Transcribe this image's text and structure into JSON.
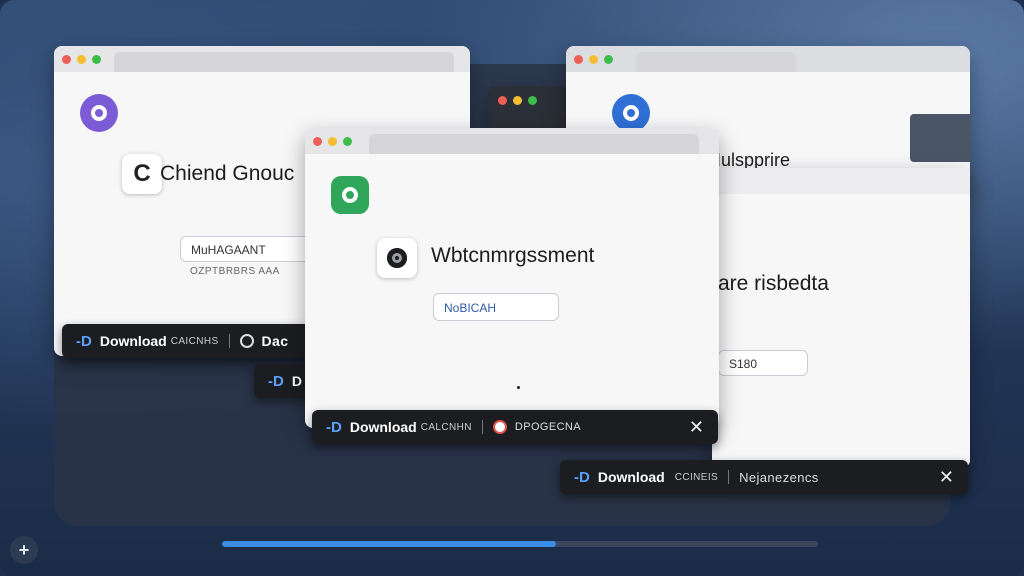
{
  "colors": {
    "accent": "#3d8ce8",
    "download_icon": "#5aa0ff",
    "purple_app": "#7b5cd6",
    "green_app": "#2fa65a",
    "blue_app": "#2f6fd6"
  },
  "windows": {
    "left": {
      "logo_icon": "purple-circle-logo-icon",
      "small_icon_glyph": "C",
      "heading": "Chiend Gnouc",
      "field_value": "MuHAGAANT",
      "subtext": "OZPTBRBRS AAA",
      "download": {
        "label": "Download",
        "sub": "CAICNHS",
        "file_name": "Dac"
      }
    },
    "center": {
      "logo_icon": "green-circle-logo-icon",
      "heading": "Wbtcnmrgssment",
      "field_value": "NoBICAH",
      "download": {
        "label": "Download",
        "sub": "CALCNHN",
        "file_name": "DPOGECNA",
        "close_glyph": "✕"
      }
    },
    "right_back": {
      "logo_icon": "blue-circle-logo-icon",
      "heading": "Iulspprire"
    },
    "right_front": {
      "heading": "are risbedta",
      "field_value": "S180",
      "download": {
        "label": "Download",
        "sub": "CCINEIS",
        "file_name": "Nejanezencs",
        "close_glyph": "✕"
      }
    },
    "hidden": {
      "download": {
        "label": "D"
      }
    }
  },
  "progress": {
    "percent": 56
  },
  "corner_button": {
    "glyph": "+"
  }
}
